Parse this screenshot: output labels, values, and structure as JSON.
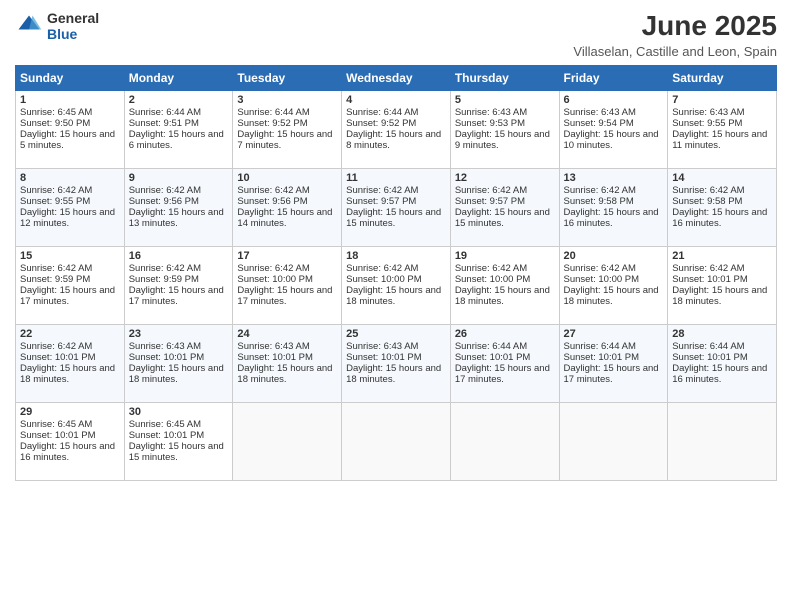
{
  "logo": {
    "general": "General",
    "blue": "Blue"
  },
  "header": {
    "title": "June 2025",
    "subtitle": "Villaselan, Castille and Leon, Spain"
  },
  "calendar": {
    "weekdays": [
      "Sunday",
      "Monday",
      "Tuesday",
      "Wednesday",
      "Thursday",
      "Friday",
      "Saturday"
    ],
    "rows": [
      [
        {
          "day": "1",
          "sunrise": "Sunrise: 6:45 AM",
          "sunset": "Sunset: 9:50 PM",
          "daylight": "Daylight: 15 hours and 5 minutes."
        },
        {
          "day": "2",
          "sunrise": "Sunrise: 6:44 AM",
          "sunset": "Sunset: 9:51 PM",
          "daylight": "Daylight: 15 hours and 6 minutes."
        },
        {
          "day": "3",
          "sunrise": "Sunrise: 6:44 AM",
          "sunset": "Sunset: 9:52 PM",
          "daylight": "Daylight: 15 hours and 7 minutes."
        },
        {
          "day": "4",
          "sunrise": "Sunrise: 6:44 AM",
          "sunset": "Sunset: 9:52 PM",
          "daylight": "Daylight: 15 hours and 8 minutes."
        },
        {
          "day": "5",
          "sunrise": "Sunrise: 6:43 AM",
          "sunset": "Sunset: 9:53 PM",
          "daylight": "Daylight: 15 hours and 9 minutes."
        },
        {
          "day": "6",
          "sunrise": "Sunrise: 6:43 AM",
          "sunset": "Sunset: 9:54 PM",
          "daylight": "Daylight: 15 hours and 10 minutes."
        },
        {
          "day": "7",
          "sunrise": "Sunrise: 6:43 AM",
          "sunset": "Sunset: 9:55 PM",
          "daylight": "Daylight: 15 hours and 11 minutes."
        }
      ],
      [
        {
          "day": "8",
          "sunrise": "Sunrise: 6:42 AM",
          "sunset": "Sunset: 9:55 PM",
          "daylight": "Daylight: 15 hours and 12 minutes."
        },
        {
          "day": "9",
          "sunrise": "Sunrise: 6:42 AM",
          "sunset": "Sunset: 9:56 PM",
          "daylight": "Daylight: 15 hours and 13 minutes."
        },
        {
          "day": "10",
          "sunrise": "Sunrise: 6:42 AM",
          "sunset": "Sunset: 9:56 PM",
          "daylight": "Daylight: 15 hours and 14 minutes."
        },
        {
          "day": "11",
          "sunrise": "Sunrise: 6:42 AM",
          "sunset": "Sunset: 9:57 PM",
          "daylight": "Daylight: 15 hours and 15 minutes."
        },
        {
          "day": "12",
          "sunrise": "Sunrise: 6:42 AM",
          "sunset": "Sunset: 9:57 PM",
          "daylight": "Daylight: 15 hours and 15 minutes."
        },
        {
          "day": "13",
          "sunrise": "Sunrise: 6:42 AM",
          "sunset": "Sunset: 9:58 PM",
          "daylight": "Daylight: 15 hours and 16 minutes."
        },
        {
          "day": "14",
          "sunrise": "Sunrise: 6:42 AM",
          "sunset": "Sunset: 9:58 PM",
          "daylight": "Daylight: 15 hours and 16 minutes."
        }
      ],
      [
        {
          "day": "15",
          "sunrise": "Sunrise: 6:42 AM",
          "sunset": "Sunset: 9:59 PM",
          "daylight": "Daylight: 15 hours and 17 minutes."
        },
        {
          "day": "16",
          "sunrise": "Sunrise: 6:42 AM",
          "sunset": "Sunset: 9:59 PM",
          "daylight": "Daylight: 15 hours and 17 minutes."
        },
        {
          "day": "17",
          "sunrise": "Sunrise: 6:42 AM",
          "sunset": "Sunset: 10:00 PM",
          "daylight": "Daylight: 15 hours and 17 minutes."
        },
        {
          "day": "18",
          "sunrise": "Sunrise: 6:42 AM",
          "sunset": "Sunset: 10:00 PM",
          "daylight": "Daylight: 15 hours and 18 minutes."
        },
        {
          "day": "19",
          "sunrise": "Sunrise: 6:42 AM",
          "sunset": "Sunset: 10:00 PM",
          "daylight": "Daylight: 15 hours and 18 minutes."
        },
        {
          "day": "20",
          "sunrise": "Sunrise: 6:42 AM",
          "sunset": "Sunset: 10:00 PM",
          "daylight": "Daylight: 15 hours and 18 minutes."
        },
        {
          "day": "21",
          "sunrise": "Sunrise: 6:42 AM",
          "sunset": "Sunset: 10:01 PM",
          "daylight": "Daylight: 15 hours and 18 minutes."
        }
      ],
      [
        {
          "day": "22",
          "sunrise": "Sunrise: 6:42 AM",
          "sunset": "Sunset: 10:01 PM",
          "daylight": "Daylight: 15 hours and 18 minutes."
        },
        {
          "day": "23",
          "sunrise": "Sunrise: 6:43 AM",
          "sunset": "Sunset: 10:01 PM",
          "daylight": "Daylight: 15 hours and 18 minutes."
        },
        {
          "day": "24",
          "sunrise": "Sunrise: 6:43 AM",
          "sunset": "Sunset: 10:01 PM",
          "daylight": "Daylight: 15 hours and 18 minutes."
        },
        {
          "day": "25",
          "sunrise": "Sunrise: 6:43 AM",
          "sunset": "Sunset: 10:01 PM",
          "daylight": "Daylight: 15 hours and 18 minutes."
        },
        {
          "day": "26",
          "sunrise": "Sunrise: 6:44 AM",
          "sunset": "Sunset: 10:01 PM",
          "daylight": "Daylight: 15 hours and 17 minutes."
        },
        {
          "day": "27",
          "sunrise": "Sunrise: 6:44 AM",
          "sunset": "Sunset: 10:01 PM",
          "daylight": "Daylight: 15 hours and 17 minutes."
        },
        {
          "day": "28",
          "sunrise": "Sunrise: 6:44 AM",
          "sunset": "Sunset: 10:01 PM",
          "daylight": "Daylight: 15 hours and 16 minutes."
        }
      ],
      [
        {
          "day": "29",
          "sunrise": "Sunrise: 6:45 AM",
          "sunset": "Sunset: 10:01 PM",
          "daylight": "Daylight: 15 hours and 16 minutes."
        },
        {
          "day": "30",
          "sunrise": "Sunrise: 6:45 AM",
          "sunset": "Sunset: 10:01 PM",
          "daylight": "Daylight: 15 hours and 15 minutes."
        },
        {
          "day": "",
          "sunrise": "",
          "sunset": "",
          "daylight": ""
        },
        {
          "day": "",
          "sunrise": "",
          "sunset": "",
          "daylight": ""
        },
        {
          "day": "",
          "sunrise": "",
          "sunset": "",
          "daylight": ""
        },
        {
          "day": "",
          "sunrise": "",
          "sunset": "",
          "daylight": ""
        },
        {
          "day": "",
          "sunrise": "",
          "sunset": "",
          "daylight": ""
        }
      ]
    ]
  }
}
